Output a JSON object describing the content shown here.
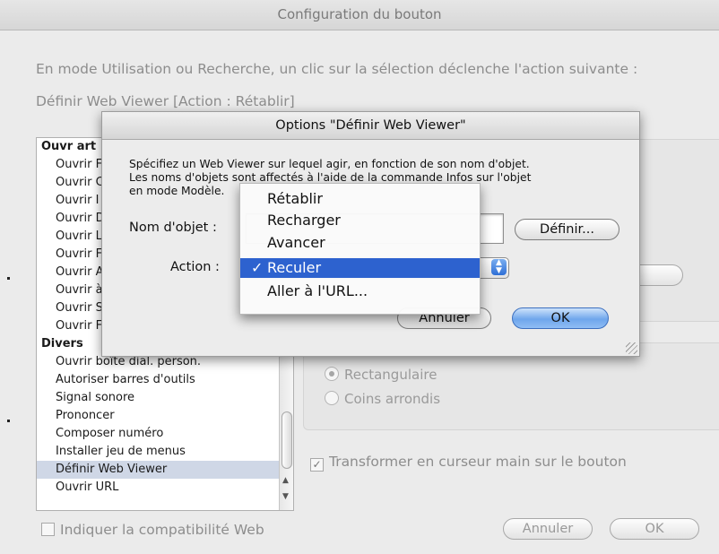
{
  "window": {
    "title": "Configuration du bouton"
  },
  "prompt_text": "En mode Utilisation ou Recherche, un clic sur la sélection déclenche l'action suivante :",
  "current_action": "Définir Web Viewer [Action : Rétablir]",
  "script_list": {
    "items": [
      {
        "label": "Ouvr art",
        "category": true
      },
      {
        "label": "Ouvrir F"
      },
      {
        "label": "Ouvrir C"
      },
      {
        "label": "Ouvrir I"
      },
      {
        "label": "Ouvrir D"
      },
      {
        "label": "Ouvrir L"
      },
      {
        "label": "Ouvrir F"
      },
      {
        "label": "Ouvrir A"
      },
      {
        "label": "Ouvrir à"
      },
      {
        "label": "Ouvrir S"
      },
      {
        "label": "Ouvrir F"
      },
      {
        "label": "Divers",
        "category": true
      },
      {
        "label": "Ouvrir boîte dial. person."
      },
      {
        "label": "Autoriser barres d'outils"
      },
      {
        "label": "Signal sonore"
      },
      {
        "label": "Prononcer"
      },
      {
        "label": "Composer numéro"
      },
      {
        "label": "Installer jeu de menus"
      },
      {
        "label": "Définir Web Viewer",
        "selected": true
      },
      {
        "label": "Ouvrir URL"
      }
    ]
  },
  "style_group": {
    "rect_label": "Rectangulaire",
    "rounded_label": "Coins arrondis",
    "selected": "Rectangulaire"
  },
  "hand_cursor": {
    "label": "Transformer en curseur main sur le bouton",
    "checked": true
  },
  "web_compat": {
    "label": "Indiquer la compatibilité Web",
    "checked": false
  },
  "main_buttons": {
    "cancel": "Annuler",
    "ok": "OK"
  },
  "sheet": {
    "title": "Options \"Définir Web Viewer\"",
    "desc_line1": "Spécifiez un Web Viewer sur lequel agir, en fonction de son nom d'objet.",
    "desc_line2": "Les noms d'objets sont affectés à l'aide de la commande Infos sur l'objet",
    "desc_line3": "en mode Modèle.",
    "object_name_label": "Nom d'objet :",
    "object_name_value": "",
    "define_button": "Définir...",
    "action_label": "Action :",
    "action_value": "Reculer",
    "cancel_button": "Annuler",
    "ok_button": "OK"
  },
  "action_menu": {
    "items": [
      "Rétablir",
      "Recharger",
      "Avancer",
      "Reculer",
      "Aller à l'URL..."
    ],
    "checked": "Reculer",
    "highlighted": "Reculer"
  },
  "colors": {
    "highlight": "#2d62cf",
    "default_button": "#6fa6ec"
  },
  "icons": {
    "check": "✓",
    "popup_arrows": "▲▼",
    "radio": "radio-icon"
  }
}
